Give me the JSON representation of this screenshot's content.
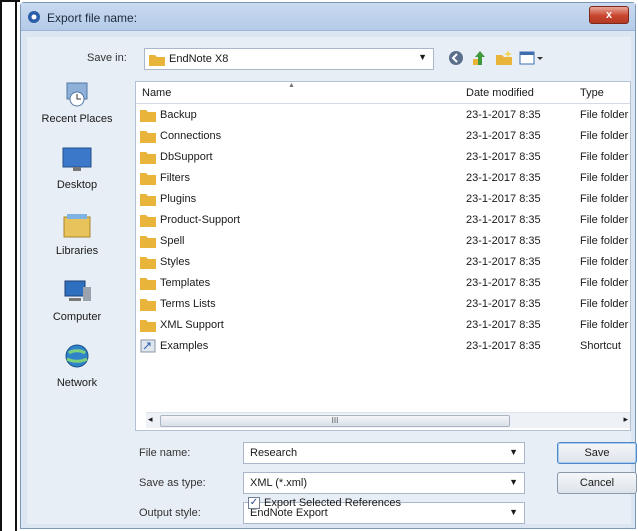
{
  "window": {
    "title": "Export file name:",
    "close_label": "x"
  },
  "save_in": {
    "label": "Save in:",
    "value": "EndNote X8"
  },
  "toolbar": {
    "icons": [
      "back-icon",
      "up-folder-icon",
      "new-folder-icon",
      "view-menu-icon"
    ]
  },
  "places": [
    {
      "label": "Recent Places",
      "icon": "recent-places-icon"
    },
    {
      "label": "Desktop",
      "icon": "desktop-icon"
    },
    {
      "label": "Libraries",
      "icon": "libraries-icon"
    },
    {
      "label": "Computer",
      "icon": "computer-icon"
    },
    {
      "label": "Network",
      "icon": "network-icon"
    }
  ],
  "columns": [
    "Name",
    "Date modified",
    "Type"
  ],
  "files": [
    {
      "name": "Backup",
      "date": "23-1-2017 8:35",
      "type": "File folder",
      "icon": "folder-icon"
    },
    {
      "name": "Connections",
      "date": "23-1-2017 8:35",
      "type": "File folder",
      "icon": "folder-icon"
    },
    {
      "name": "DbSupport",
      "date": "23-1-2017 8:35",
      "type": "File folder",
      "icon": "folder-icon"
    },
    {
      "name": "Filters",
      "date": "23-1-2017 8:35",
      "type": "File folder",
      "icon": "folder-icon"
    },
    {
      "name": "Plugins",
      "date": "23-1-2017 8:35",
      "type": "File folder",
      "icon": "folder-icon"
    },
    {
      "name": "Product-Support",
      "date": "23-1-2017 8:35",
      "type": "File folder",
      "icon": "folder-icon"
    },
    {
      "name": "Spell",
      "date": "23-1-2017 8:35",
      "type": "File folder",
      "icon": "folder-icon"
    },
    {
      "name": "Styles",
      "date": "23-1-2017 8:35",
      "type": "File folder",
      "icon": "folder-icon"
    },
    {
      "name": "Templates",
      "date": "23-1-2017 8:35",
      "type": "File folder",
      "icon": "folder-icon"
    },
    {
      "name": "Terms Lists",
      "date": "23-1-2017 8:35",
      "type": "File folder",
      "icon": "folder-icon"
    },
    {
      "name": "XML Support",
      "date": "23-1-2017 8:35",
      "type": "File folder",
      "icon": "folder-icon"
    },
    {
      "name": "Examples",
      "date": "23-1-2017 8:35",
      "type": "Shortcut",
      "icon": "shortcut-icon"
    }
  ],
  "form": {
    "file_name_label": "File name:",
    "file_name_value": "Research",
    "save_as_type_label": "Save as type:",
    "save_as_type_value": "XML (*.xml)",
    "output_style_label": "Output style:",
    "output_style_value": "EndNote Export",
    "export_selected_label": "Export Selected References",
    "export_selected_checked": true
  },
  "buttons": {
    "save": "Save",
    "cancel": "Cancel"
  },
  "colors": {
    "folder": "#e8b53a",
    "titlebar": "#b4cbe8",
    "close": "#c9452f"
  }
}
